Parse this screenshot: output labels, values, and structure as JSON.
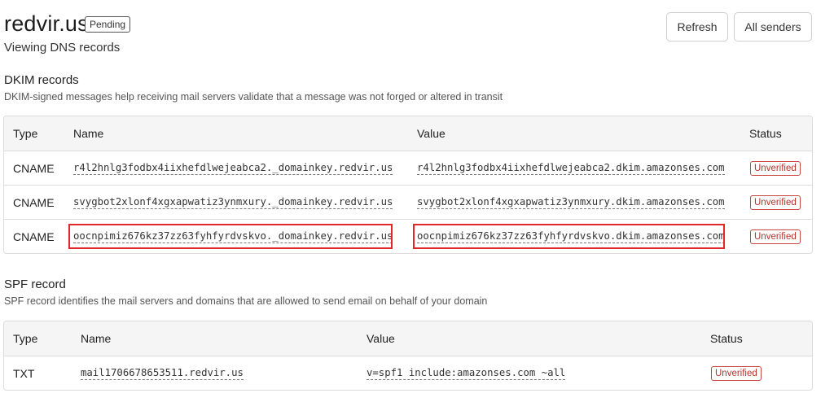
{
  "header": {
    "title": "redvir.us",
    "badge": "Pending",
    "subtitle": "Viewing DNS records",
    "refresh_label": "Refresh",
    "all_senders_label": "All senders"
  },
  "dkim": {
    "title": "DKIM records",
    "description": "DKIM-signed messages help receiving mail servers validate that a message was not forged or altered in transit",
    "columns": [
      "Type",
      "Name",
      "Value",
      "Status"
    ],
    "rows": [
      {
        "type": "CNAME",
        "name": "r4l2hnlg3fodbx4iixhefdlwejeabca2._domainkey.redvir.us",
        "value": "r4l2hnlg3fodbx4iixhefdlwejeabca2.dkim.amazonses.com",
        "status": "Unverified"
      },
      {
        "type": "CNAME",
        "name": "svygbot2xlonf4xgxapwatiz3ynmxury._domainkey.redvir.us",
        "value": "svygbot2xlonf4xgxapwatiz3ynmxury.dkim.amazonses.com",
        "status": "Unverified"
      },
      {
        "type": "CNAME",
        "name": "oocnpimiz676kz37zz63fyhfyrdvskvo._domainkey.redvir.us",
        "value": "oocnpimiz676kz37zz63fyhfyrdvskvo.dkim.amazonses.com",
        "status": "Unverified"
      }
    ]
  },
  "spf": {
    "title": "SPF record",
    "description": "SPF record identifies the mail servers and domains that are allowed to send email on behalf of your domain",
    "columns": [
      "Type",
      "Name",
      "Value",
      "Status"
    ],
    "rows": [
      {
        "type": "TXT",
        "name": "mail1706678653511.redvir.us",
        "value": "v=spf1 include:amazonses.com ~all",
        "status": "Unverified"
      }
    ]
  },
  "colors": {
    "highlight": "#e02828",
    "status_red": "#b9302a",
    "header_bg": "#f5f5f5"
  }
}
